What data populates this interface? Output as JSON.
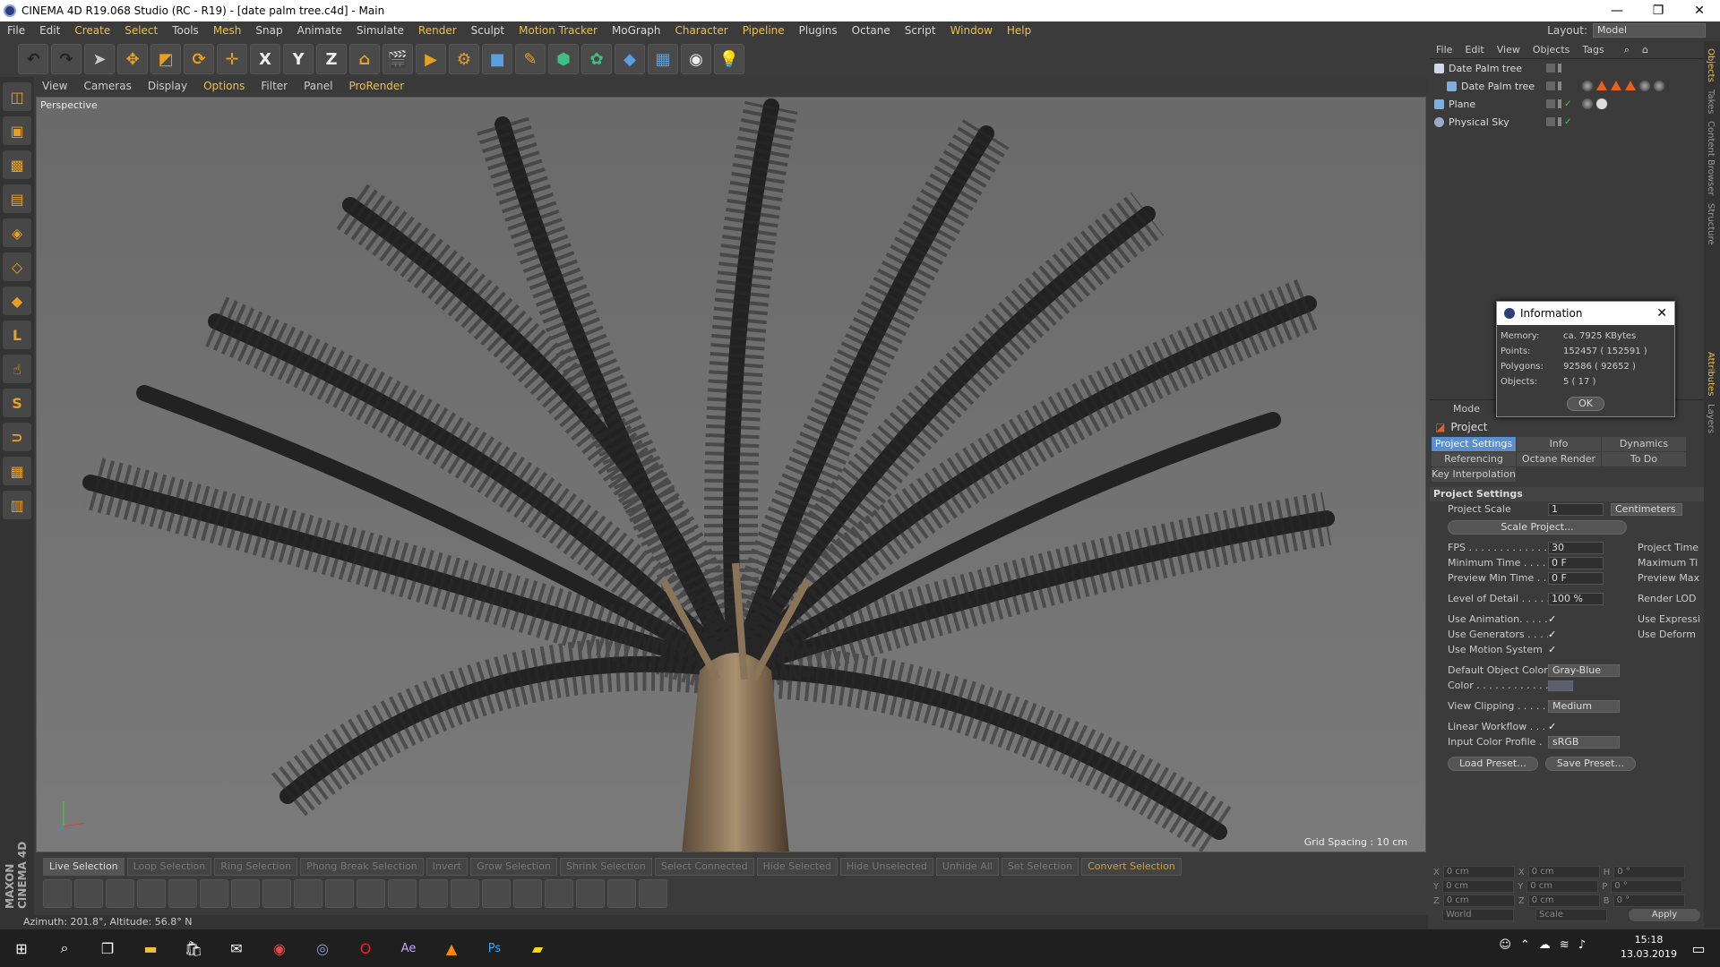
{
  "window": {
    "title": "CINEMA 4D R19.068 Studio (RC - R19) - [date palm tree.c4d] - Main"
  },
  "menu": [
    "File",
    "Edit",
    "Create",
    "Select",
    "Tools",
    "Mesh",
    "Snap",
    "Animate",
    "Simulate",
    "Render",
    "Sculpt",
    "Motion Tracker",
    "MoGraph",
    "Character",
    "Pipeline",
    "Plugins",
    "Octane",
    "Script",
    "Window",
    "Help"
  ],
  "layout": {
    "label": "Layout:",
    "value": "Model"
  },
  "viewport_menu": [
    "View",
    "Cameras",
    "Display",
    "Options",
    "Filter",
    "Panel",
    "ProRender"
  ],
  "viewport": {
    "label": "Perspective",
    "grid_spacing": "Grid Spacing : 10 cm"
  },
  "selection_bar": [
    "Live Selection",
    "Loop Selection",
    "Ring Selection",
    "Phong Break Selection",
    "Invert",
    "Grow Selection",
    "Shrink Selection",
    "Select Connected",
    "Hide Selected",
    "Hide Unselected",
    "Unhide All",
    "Set Selection",
    "Convert Selection"
  ],
  "status": "Azimuth: 201.8°, Altitude: 56.8°  N",
  "brand": "MAXON CINEMA 4D",
  "object_menu": [
    "File",
    "Edit",
    "View",
    "Objects",
    "Tags"
  ],
  "objects": [
    {
      "name": "Date Palm tree"
    },
    {
      "name": "Date Palm tree"
    },
    {
      "name": "Plane"
    },
    {
      "name": "Physical Sky"
    }
  ],
  "attributes": {
    "mode": "Mode",
    "header": "Project",
    "tabs": [
      "Project Settings",
      "Info",
      "Dynamics",
      "Referencing",
      "Octane Render",
      "To Do",
      "Key Interpolation"
    ],
    "section": "Project Settings",
    "project_scale": {
      "label": "Project Scale",
      "value": "1",
      "unit": "Centimeters"
    },
    "scale_button": "Scale Project...",
    "fps": {
      "label": "FPS . . . . . . . . . . . . .",
      "value": "30",
      "right": "Project Time"
    },
    "min_time": {
      "label": "Minimum Time . . . . .",
      "value": "0 F",
      "right": "Maximum Ti"
    },
    "preview_min": {
      "label": "Preview Min Time . . .",
      "value": "0 F",
      "right": "Preview Max"
    },
    "lod": {
      "label": "Level of Detail . . . . .",
      "value": "100 %",
      "right": "Render LOD"
    },
    "use_animation": {
      "label": "Use Animation. . . . .",
      "right": "Use Expressi"
    },
    "use_generators": {
      "label": "Use Generators . . . .",
      "right": "Use Deform"
    },
    "use_motion": {
      "label": "Use Motion System"
    },
    "default_color": {
      "label": "Default Object Color",
      "value": "Gray-Blue"
    },
    "color": {
      "label": "Color . . . . . . . . . . . ."
    },
    "view_clipping": {
      "label": "View Clipping . . . . .",
      "value": "Medium"
    },
    "linear_workflow": {
      "label": "Linear Workflow . . ."
    },
    "input_color": {
      "label": "Input Color Profile .",
      "value": "sRGB"
    },
    "load_preset": "Load Preset...",
    "save_preset": "Save Preset...",
    "check": "✓"
  },
  "coords": {
    "rows": [
      [
        "X",
        "0 cm",
        "X",
        "0 cm",
        "H",
        "0 °"
      ],
      [
        "Y",
        "0 cm",
        "Y",
        "0 cm",
        "P",
        "0 °"
      ],
      [
        "Z",
        "0 cm",
        "Z",
        "0 cm",
        "B",
        "0 °"
      ]
    ],
    "world": "World",
    "scale": "Scale",
    "apply": "Apply"
  },
  "info_dialog": {
    "title": "Information",
    "memory_k": "Memory:",
    "memory_v": "ca. 7925 KBytes",
    "points_k": "Points:",
    "points_v": "152457 ( 152591 )",
    "polys_k": "Polygons:",
    "polys_v": "92586 ( 92652 )",
    "objects_k": "Objects:",
    "objects_v": "5 ( 17 )",
    "ok": "OK"
  },
  "sidetabs": [
    "Objects",
    "Takes",
    "Content Browser",
    "Structure",
    "Attributes",
    "Layers"
  ],
  "taskbar": {
    "time": "15:18",
    "date": "13.03.2019"
  },
  "toolbar_axes": [
    "X",
    "Y",
    "Z"
  ],
  "colors": {
    "accent": "#f0c040",
    "tab_active": "#5a8ed0",
    "orange_icon": "#e8a020"
  }
}
